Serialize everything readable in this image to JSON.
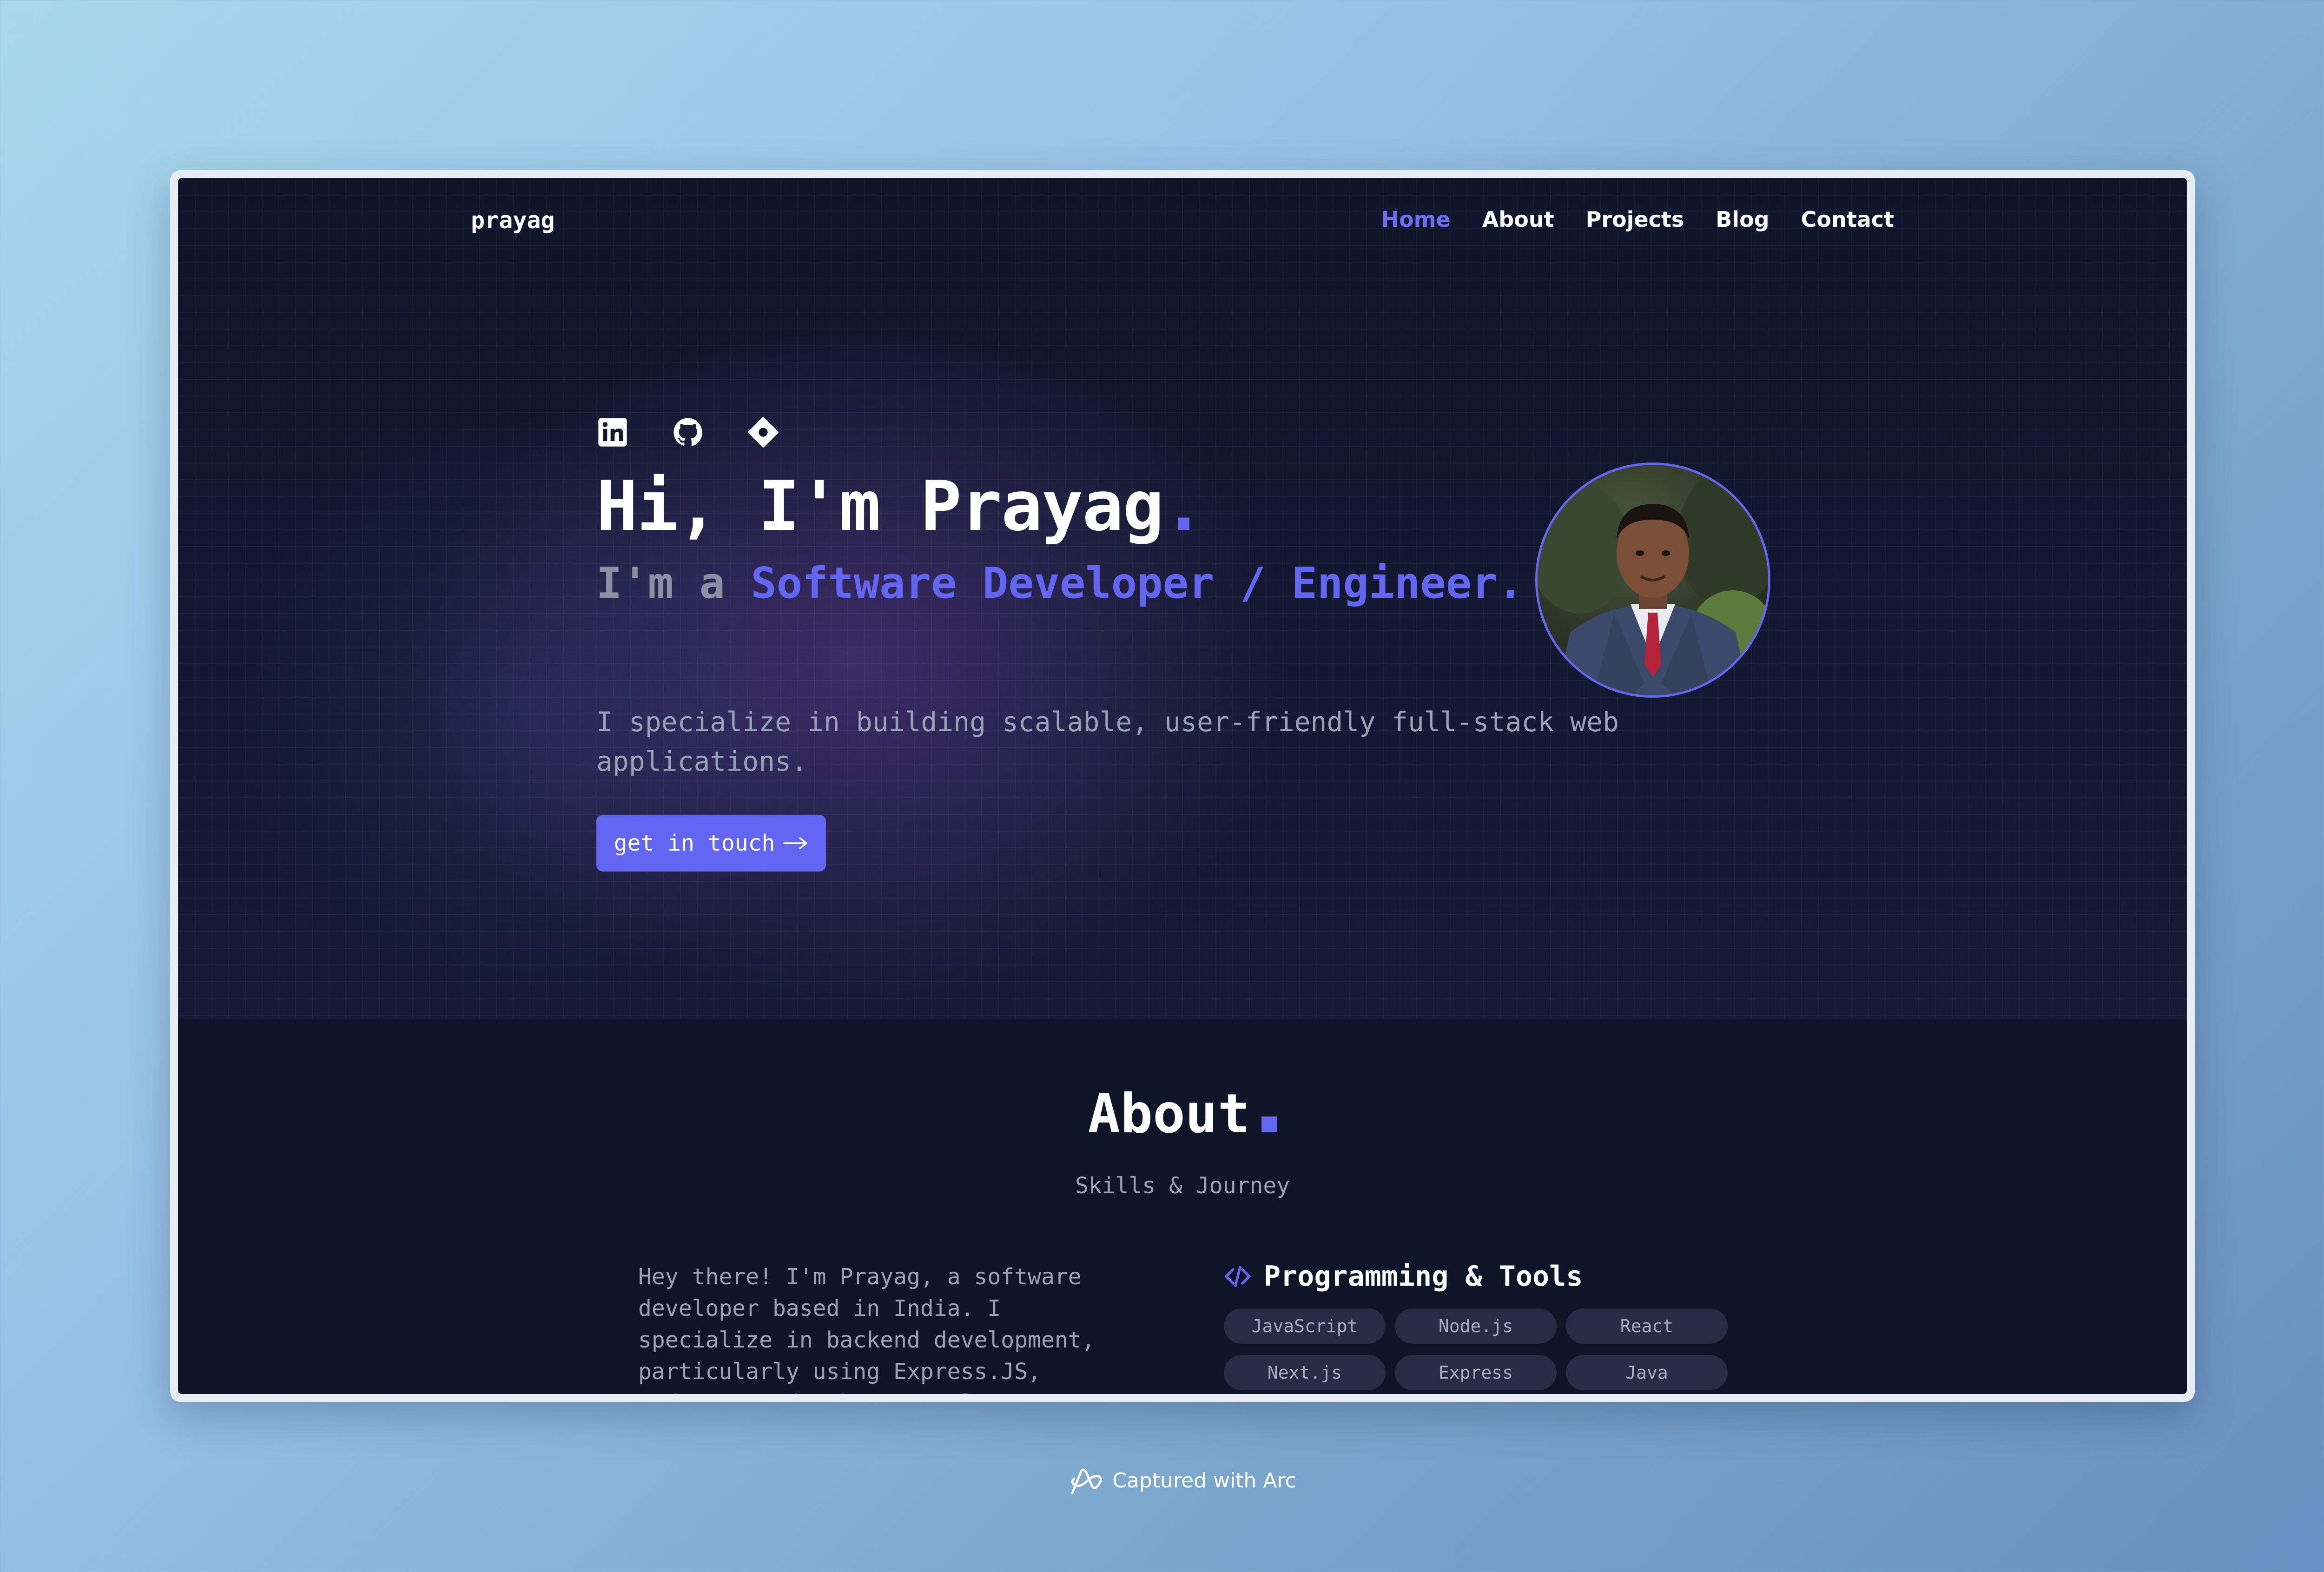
{
  "nav": {
    "brand": "prayag",
    "links": [
      "Home",
      "About",
      "Projects",
      "Blog",
      "Contact"
    ],
    "active": "Home"
  },
  "hero": {
    "socials": [
      "linkedin-icon",
      "github-icon",
      "diamond-icon"
    ],
    "greeting": "Hi, I'm Prayag",
    "greeting_dot": ".",
    "role_prefix": "I'm a ",
    "role_title": "Software Developer / Engineer.",
    "lead": "I specialize in building scalable, user-friendly full-stack web applications.",
    "cta_label": "get in touch",
    "cta_icon": "arrow-right-icon"
  },
  "about": {
    "title": "About",
    "subtitle": "Skills & Journey",
    "bio": "Hey there! I'm Prayag, a software developer based in India. I specialize in backend development, particularly using Express.JS, Node.JS, and , but I'm also comfortable with various tools",
    "programming_title": "Programming & Tools",
    "skills": [
      "JavaScript",
      "Node.js",
      "React",
      "Next.js",
      "Express",
      "Java"
    ]
  },
  "footer": {
    "capture_label": "Captured with Arc"
  },
  "colors": {
    "accent": "#6366f1",
    "background": "#0f1529",
    "chip_bg": "#252c43"
  }
}
